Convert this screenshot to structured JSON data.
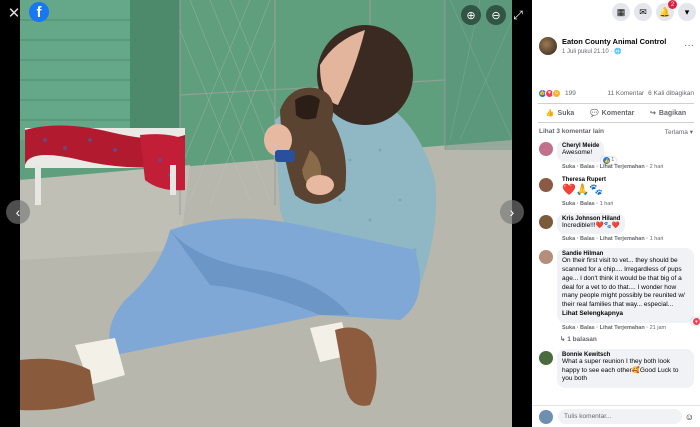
{
  "viewer": {
    "close_icon": "close-icon",
    "brand_icon_text": "f",
    "prev_icon": "chevron-left-icon",
    "next_icon": "chevron-right-icon"
  },
  "topbar": {
    "notification_count": "2"
  },
  "post": {
    "page_name": "Eaton County Animal Control",
    "timestamp": "1 Juli pukul 21.10 · ",
    "reaction_count": "199",
    "comment_count": "11 Komentar",
    "share_count": "6 Kali dibagikan",
    "like_label": "Suka",
    "comment_label": "Komentar",
    "share_label": "Bagikan"
  },
  "comments_header": {
    "view_more": "Lihat 3 komentar lain",
    "sort": "Terlama"
  },
  "comments": [
    {
      "name": "Cheryl Meide",
      "text": "Awesome!",
      "meta_actions": "Suka · Balas · Lihat Terjemahan · ",
      "age": "2 hari",
      "reactions": "1",
      "avatar_color": "#c2718c"
    },
    {
      "name": "Theresa Rupert",
      "text": "❤️🙏🐾",
      "meta_actions": "Suka · Balas · ",
      "age": "1 hari",
      "avatar_color": "#8a5a44"
    },
    {
      "name": "Kris Johnson Hiland",
      "text": "Incredible!!!❤️🐾❤️",
      "meta_actions": "Suka · Balas · Lihat Terjemahan · ",
      "age": "1 hari",
      "avatar_color": "#7a5c3c"
    },
    {
      "name": "Sandie Hilman",
      "text": "On their first visit to vet... they should be scanned for a chip.... Irregardless of pups age... I don't think it would be that big of a deal for a vet to do that.... I wonder how many people might possibly be reunited w/ their real families that way... especial...",
      "see_more": "Lihat Selengkapnya",
      "meta_actions": "Suka · Balas · Lihat Terjemahan · ",
      "age": "21 jam",
      "reactions": "1",
      "replies": "1 balasan",
      "avatar_color": "#b58e7a"
    },
    {
      "name": "Bonnie Kewitsch",
      "text": "What a super reunion I they both look happy to see each other🥰Good Luck to you both",
      "avatar_color": "#4a6b3e"
    }
  ],
  "composer": {
    "placeholder": "Tulis komentar..."
  },
  "colors": {
    "facebook_blue": "#1877f2",
    "notification_red": "#e41e3f",
    "panel_bg": "#ffffff",
    "bubble_bg": "#f0f2f5"
  }
}
